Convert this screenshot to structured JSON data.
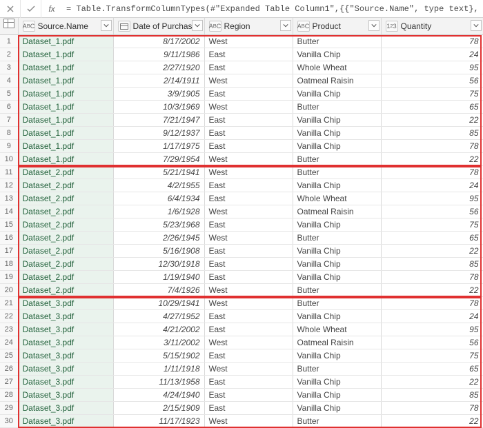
{
  "formula": "= Table.TransformColumnTypes(#\"Expanded Table Column1\",{{\"Source.Name\", type text}, {\"Date of Purchase\", type",
  "columns": {
    "source": {
      "label": "Source.Name",
      "type": "ABC"
    },
    "date": {
      "label": "Date of Purchase",
      "type": "cal"
    },
    "region": {
      "label": "Region",
      "type": "ABC"
    },
    "product": {
      "label": "Product",
      "type": "ABC"
    },
    "qty": {
      "label": "Quantity",
      "type": "123"
    }
  },
  "rows": [
    {
      "n": 1,
      "source": "Dataset_1.pdf",
      "date": "8/17/2002",
      "region": "West",
      "product": "Butter",
      "qty": 78
    },
    {
      "n": 2,
      "source": "Dataset_1.pdf",
      "date": "9/11/1986",
      "region": "East",
      "product": "Vanilla Chip",
      "qty": 24
    },
    {
      "n": 3,
      "source": "Dataset_1.pdf",
      "date": "2/27/1920",
      "region": "East",
      "product": "Whole Wheat",
      "qty": 95
    },
    {
      "n": 4,
      "source": "Dataset_1.pdf",
      "date": "2/14/1911",
      "region": "West",
      "product": "Oatmeal Raisin",
      "qty": 56
    },
    {
      "n": 5,
      "source": "Dataset_1.pdf",
      "date": "3/9/1905",
      "region": "East",
      "product": "Vanilla Chip",
      "qty": 75
    },
    {
      "n": 6,
      "source": "Dataset_1.pdf",
      "date": "10/3/1969",
      "region": "West",
      "product": "Butter",
      "qty": 65
    },
    {
      "n": 7,
      "source": "Dataset_1.pdf",
      "date": "7/21/1947",
      "region": "East",
      "product": "Vanilla Chip",
      "qty": 22
    },
    {
      "n": 8,
      "source": "Dataset_1.pdf",
      "date": "9/12/1937",
      "region": "East",
      "product": "Vanilla Chip",
      "qty": 85
    },
    {
      "n": 9,
      "source": "Dataset_1.pdf",
      "date": "1/17/1975",
      "region": "East",
      "product": "Vanilla Chip",
      "qty": 78
    },
    {
      "n": 10,
      "source": "Dataset_1.pdf",
      "date": "7/29/1954",
      "region": "West",
      "product": "Butter",
      "qty": 22
    },
    {
      "n": 11,
      "source": "Dataset_2.pdf",
      "date": "5/21/1941",
      "region": "West",
      "product": "Butter",
      "qty": 78
    },
    {
      "n": 12,
      "source": "Dataset_2.pdf",
      "date": "4/2/1955",
      "region": "East",
      "product": "Vanilla Chip",
      "qty": 24
    },
    {
      "n": 13,
      "source": "Dataset_2.pdf",
      "date": "6/4/1934",
      "region": "East",
      "product": "Whole Wheat",
      "qty": 95
    },
    {
      "n": 14,
      "source": "Dataset_2.pdf",
      "date": "1/6/1928",
      "region": "West",
      "product": "Oatmeal Raisin",
      "qty": 56
    },
    {
      "n": 15,
      "source": "Dataset_2.pdf",
      "date": "5/23/1968",
      "region": "East",
      "product": "Vanilla Chip",
      "qty": 75
    },
    {
      "n": 16,
      "source": "Dataset_2.pdf",
      "date": "2/26/1945",
      "region": "West",
      "product": "Butter",
      "qty": 65
    },
    {
      "n": 17,
      "source": "Dataset_2.pdf",
      "date": "5/16/1908",
      "region": "East",
      "product": "Vanilla Chip",
      "qty": 22
    },
    {
      "n": 18,
      "source": "Dataset_2.pdf",
      "date": "12/30/1918",
      "region": "East",
      "product": "Vanilla Chip",
      "qty": 85
    },
    {
      "n": 19,
      "source": "Dataset_2.pdf",
      "date": "1/19/1940",
      "region": "East",
      "product": "Vanilla Chip",
      "qty": 78
    },
    {
      "n": 20,
      "source": "Dataset_2.pdf",
      "date": "7/4/1926",
      "region": "West",
      "product": "Butter",
      "qty": 22
    },
    {
      "n": 21,
      "source": "Dataset_3.pdf",
      "date": "10/29/1941",
      "region": "West",
      "product": "Butter",
      "qty": 78
    },
    {
      "n": 22,
      "source": "Dataset_3.pdf",
      "date": "4/27/1952",
      "region": "East",
      "product": "Vanilla Chip",
      "qty": 24
    },
    {
      "n": 23,
      "source": "Dataset_3.pdf",
      "date": "4/21/2002",
      "region": "East",
      "product": "Whole Wheat",
      "qty": 95
    },
    {
      "n": 24,
      "source": "Dataset_3.pdf",
      "date": "3/11/2002",
      "region": "West",
      "product": "Oatmeal Raisin",
      "qty": 56
    },
    {
      "n": 25,
      "source": "Dataset_3.pdf",
      "date": "5/15/1902",
      "region": "East",
      "product": "Vanilla Chip",
      "qty": 75
    },
    {
      "n": 26,
      "source": "Dataset_3.pdf",
      "date": "1/11/1918",
      "region": "West",
      "product": "Butter",
      "qty": 65
    },
    {
      "n": 27,
      "source": "Dataset_3.pdf",
      "date": "11/13/1958",
      "region": "East",
      "product": "Vanilla Chip",
      "qty": 22
    },
    {
      "n": 28,
      "source": "Dataset_3.pdf",
      "date": "4/24/1940",
      "region": "East",
      "product": "Vanilla Chip",
      "qty": 85
    },
    {
      "n": 29,
      "source": "Dataset_3.pdf",
      "date": "2/15/1909",
      "region": "East",
      "product": "Vanilla Chip",
      "qty": 78
    },
    {
      "n": 30,
      "source": "Dataset_3.pdf",
      "date": "11/17/1923",
      "region": "West",
      "product": "Butter",
      "qty": 22
    }
  ]
}
